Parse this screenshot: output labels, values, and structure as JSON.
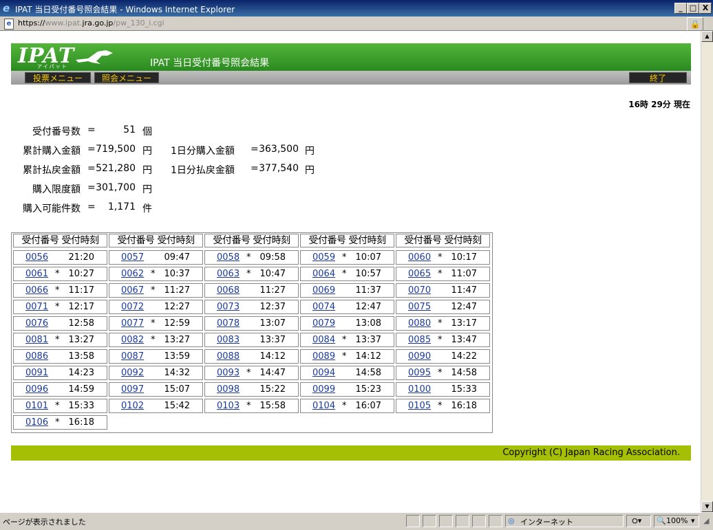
{
  "window": {
    "title": "IPAT 当日受付番号照会結果 - Windows Internet Explorer",
    "min": "_",
    "max": "□",
    "close": "X"
  },
  "address": {
    "scheme": "https://",
    "host_pre": "www.ipat.",
    "host_main": "jra.go.jp",
    "path": "/pw_130_i.cgi"
  },
  "header": {
    "logo": "IPAT",
    "logo_sub": "アイパット",
    "page_title": "IPAT 当日受付番号照会結果"
  },
  "menu": {
    "vote_menu": "投票メニュー",
    "inquiry_menu": "照会メニュー",
    "end": "終了"
  },
  "time_status": "16時 29分 現在",
  "summary": [
    {
      "label": "受付番号数",
      "eq": "=",
      "value": "51",
      "unit": "個"
    },
    {
      "label": "累計購入金額",
      "eq": "=",
      "value": "719,500",
      "unit": "円",
      "extra_label": "1日分購入金額",
      "extra_eq": "=",
      "extra_value": "363,500",
      "extra_unit": "円"
    },
    {
      "label": "累計払戻金額",
      "eq": "=",
      "value": "521,280",
      "unit": "円",
      "extra_label": "1日分払戻金額",
      "extra_eq": "=",
      "extra_value": "377,540",
      "extra_unit": "円"
    },
    {
      "label": "購入限度額",
      "eq": "=",
      "value": "301,700",
      "unit": "円"
    },
    {
      "label": "購入可能件数",
      "eq": "=",
      "value": "1,171",
      "unit": "件"
    }
  ],
  "table": {
    "header": "受付番号 受付時刻",
    "entries": [
      {
        "num": "0056",
        "star": "",
        "time": "21:20"
      },
      {
        "num": "0057",
        "star": "",
        "time": "09:47"
      },
      {
        "num": "0058",
        "star": "*",
        "time": "09:58"
      },
      {
        "num": "0059",
        "star": "*",
        "time": "10:07"
      },
      {
        "num": "0060",
        "star": "*",
        "time": "10:17"
      },
      {
        "num": "0061",
        "star": "*",
        "time": "10:27"
      },
      {
        "num": "0062",
        "star": "*",
        "time": "10:37"
      },
      {
        "num": "0063",
        "star": "*",
        "time": "10:47"
      },
      {
        "num": "0064",
        "star": "*",
        "time": "10:57"
      },
      {
        "num": "0065",
        "star": "*",
        "time": "11:07"
      },
      {
        "num": "0066",
        "star": "*",
        "time": "11:17"
      },
      {
        "num": "0067",
        "star": "*",
        "time": "11:27"
      },
      {
        "num": "0068",
        "star": "",
        "time": "11:27"
      },
      {
        "num": "0069",
        "star": "",
        "time": "11:37"
      },
      {
        "num": "0070",
        "star": "",
        "time": "11:47"
      },
      {
        "num": "0071",
        "star": "*",
        "time": "12:17"
      },
      {
        "num": "0072",
        "star": "",
        "time": "12:27"
      },
      {
        "num": "0073",
        "star": "",
        "time": "12:37"
      },
      {
        "num": "0074",
        "star": "",
        "time": "12:47"
      },
      {
        "num": "0075",
        "star": "",
        "time": "12:47"
      },
      {
        "num": "0076",
        "star": "",
        "time": "12:58"
      },
      {
        "num": "0077",
        "star": "*",
        "time": "12:59"
      },
      {
        "num": "0078",
        "star": "",
        "time": "13:07"
      },
      {
        "num": "0079",
        "star": "",
        "time": "13:08"
      },
      {
        "num": "0080",
        "star": "*",
        "time": "13:17"
      },
      {
        "num": "0081",
        "star": "*",
        "time": "13:27"
      },
      {
        "num": "0082",
        "star": "*",
        "time": "13:27"
      },
      {
        "num": "0083",
        "star": "",
        "time": "13:37"
      },
      {
        "num": "0084",
        "star": "*",
        "time": "13:37"
      },
      {
        "num": "0085",
        "star": "*",
        "time": "13:47"
      },
      {
        "num": "0086",
        "star": "",
        "time": "13:58"
      },
      {
        "num": "0087",
        "star": "",
        "time": "13:59"
      },
      {
        "num": "0088",
        "star": "",
        "time": "14:12"
      },
      {
        "num": "0089",
        "star": "*",
        "time": "14:12"
      },
      {
        "num": "0090",
        "star": "",
        "time": "14:22"
      },
      {
        "num": "0091",
        "star": "",
        "time": "14:23"
      },
      {
        "num": "0092",
        "star": "",
        "time": "14:32"
      },
      {
        "num": "0093",
        "star": "*",
        "time": "14:47"
      },
      {
        "num": "0094",
        "star": "",
        "time": "14:58"
      },
      {
        "num": "0095",
        "star": "*",
        "time": "14:58"
      },
      {
        "num": "0096",
        "star": "",
        "time": "14:59"
      },
      {
        "num": "0097",
        "star": "",
        "time": "15:07"
      },
      {
        "num": "0098",
        "star": "",
        "time": "15:22"
      },
      {
        "num": "0099",
        "star": "",
        "time": "15:23"
      },
      {
        "num": "0100",
        "star": "",
        "time": "15:33"
      },
      {
        "num": "0101",
        "star": "*",
        "time": "15:33"
      },
      {
        "num": "0102",
        "star": "",
        "time": "15:42"
      },
      {
        "num": "0103",
        "star": "*",
        "time": "15:58"
      },
      {
        "num": "0104",
        "star": "*",
        "time": "16:07"
      },
      {
        "num": "0105",
        "star": "*",
        "time": "16:18"
      },
      {
        "num": "0106",
        "star": "*",
        "time": "16:18"
      }
    ]
  },
  "footer": {
    "copyright": "Copyright (C) Japan Racing Association."
  },
  "status": {
    "text": "ページが表示されました",
    "zone": "インターネット",
    "zoom": "100%"
  },
  "colors": {
    "header_green": "#3a9a2a",
    "footer_lime": "#a5bf05",
    "menu_text": "#f5c800",
    "link": "#1a3a9a"
  }
}
